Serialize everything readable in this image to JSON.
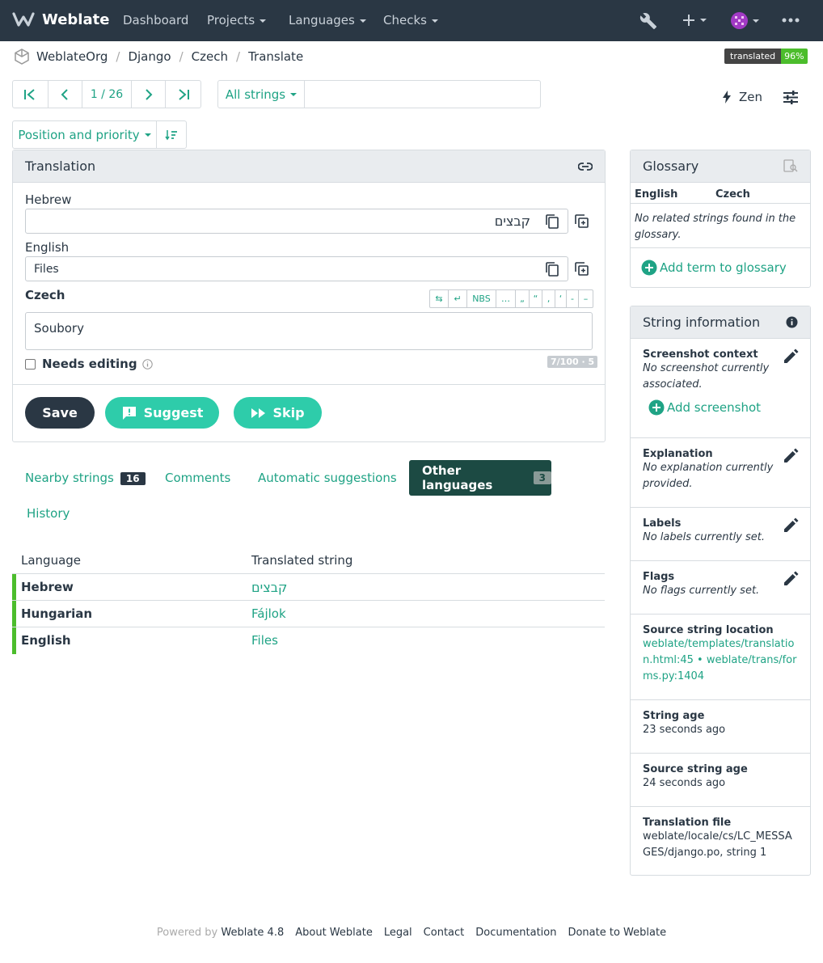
{
  "nav": {
    "brand": "Weblate",
    "items": [
      "Dashboard",
      "Projects",
      "Languages",
      "Checks"
    ]
  },
  "breadcrumb": [
    "WeblateOrg",
    "Django",
    "Czech",
    "Translate"
  ],
  "translated_badge": {
    "label": "translated",
    "value": "96%"
  },
  "pager": {
    "position": "1 / 26"
  },
  "filter": {
    "label": "All strings",
    "search_value": ""
  },
  "zen_label": "Zen",
  "sort": {
    "label": "Position and priority"
  },
  "translation_panel": {
    "title": "Translation",
    "hebrew_label": "Hebrew",
    "hebrew_value": "קבצים",
    "english_label": "English",
    "english_value": "Files",
    "czech_label": "Czech",
    "czech_value": "Soubory",
    "tools": [
      "⇆",
      "↵",
      "NBS",
      "…",
      "„",
      "“",
      "‚",
      "‘",
      "-",
      "–"
    ],
    "needs_editing": "Needs editing",
    "counter": "7/100 · 5",
    "save": "Save",
    "suggest": "Suggest",
    "skip": "Skip"
  },
  "tabs": [
    {
      "label": "Nearby strings",
      "count": "16"
    },
    {
      "label": "Comments"
    },
    {
      "label": "Automatic suggestions"
    },
    {
      "label": "Other languages",
      "count": "3"
    },
    {
      "label": "History"
    }
  ],
  "other_languages": {
    "headers": [
      "Language",
      "Translated string"
    ],
    "rows": [
      {
        "language": "Hebrew",
        "string": "קבצים"
      },
      {
        "language": "Hungarian",
        "string": "Fájlok"
      },
      {
        "language": "English",
        "string": "Files"
      }
    ]
  },
  "glossary": {
    "title": "Glossary",
    "col_source": "English",
    "col_target": "Czech",
    "empty": "No related strings found in the glossary.",
    "add": "Add term to glossary"
  },
  "string_info": {
    "title": "String information",
    "screenshot_title": "Screenshot context",
    "screenshot_text": "No screenshot currently associated.",
    "add_screenshot": "Add screenshot",
    "explanation_title": "Explanation",
    "explanation_text": "No explanation currently provided.",
    "labels_title": "Labels",
    "labels_text": "No labels currently set.",
    "flags_title": "Flags",
    "flags_text": "No flags currently set.",
    "location_title": "Source string location",
    "location_1": "weblate/templates/translation.html:45",
    "location_sep": "•",
    "location_2": "weblate/trans/forms.py:1404",
    "age_title": "String age",
    "age_value": "23 seconds ago",
    "source_age_title": "Source string age",
    "source_age_value": "24 seconds ago",
    "file_title": "Translation file",
    "file_value": "weblate/locale/cs/LC_MESSAGES/django.po, string 1"
  },
  "footer": {
    "powered_by": "Powered by",
    "version": "Weblate 4.8",
    "links": [
      "About Weblate",
      "Legal",
      "Contact",
      "Documentation",
      "Donate to Weblate"
    ]
  },
  "colors": {
    "accent": "#1fa385",
    "dark": "#2a3744",
    "green": "#4cbd2c"
  }
}
